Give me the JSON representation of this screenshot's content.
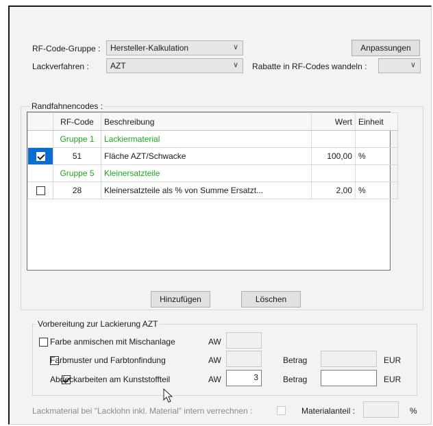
{
  "top": {
    "rf_code_gruppe_label": "RF-Code-Gruppe :",
    "rf_code_gruppe_value": "Hersteller-Kalkulation",
    "lackverfahren_label": "Lackverfahren :",
    "lackverfahren_value": "AZT",
    "rabatte_label": "Rabatte in RF-Codes wandeln :",
    "rabatte_value": "",
    "anpassungen_button": "Anpassungen"
  },
  "randfahnencodes": {
    "legend": "Randfahnencodes :",
    "columns": {
      "rf_code": "RF-Code",
      "beschreibung": "Beschreibung",
      "wert": "Wert",
      "einheit": "Einheit"
    },
    "rows": [
      {
        "type": "group",
        "rf_code": "Gruppe 1",
        "beschreibung": "Lackiermaterial"
      },
      {
        "type": "item",
        "checked": true,
        "selected": true,
        "rf_code": "51",
        "beschreibung": "Fläche  AZT/Schwacke",
        "wert": "100,00",
        "einheit": "%"
      },
      {
        "type": "group",
        "rf_code": "Gruppe 5",
        "beschreibung": "Kleinersatzteile"
      },
      {
        "type": "item",
        "checked": false,
        "selected": false,
        "rf_code": "28",
        "beschreibung": "Kleinersatzteile als % von Summe Ersatzt...",
        "wert": "2,00",
        "einheit": "%"
      }
    ],
    "add_button": "Hinzufügen",
    "delete_button": "Löschen"
  },
  "vorbereitung": {
    "legend": "Vorbereitung zur Lackierung AZT",
    "farbe": {
      "label": "Farbe anmischen mit Mischanlage",
      "checked": false,
      "aw_label": "AW"
    },
    "farbmuster": {
      "label": "Farbmuster und Farbtonfindung",
      "checked": false,
      "aw_label": "AW",
      "betrag_label": "Betrag",
      "eur_label": "EUR"
    },
    "abdeck": {
      "label": "Abdeckarbeiten am Kunststoffteil",
      "checked": true,
      "aw_label": "AW",
      "aw_value": "3",
      "betrag_label": "Betrag",
      "betrag_value": "",
      "eur_label": "EUR"
    }
  },
  "bottom": {
    "lackmaterial_label": "Lackmaterial bei \"Lacklohn inkl. Material\" intern verrechnen :",
    "materialanteil_label": "Materialanteil :",
    "percent": "%"
  },
  "colors": {
    "group_text": "#1da81d",
    "selection": "#0a6ed1"
  }
}
